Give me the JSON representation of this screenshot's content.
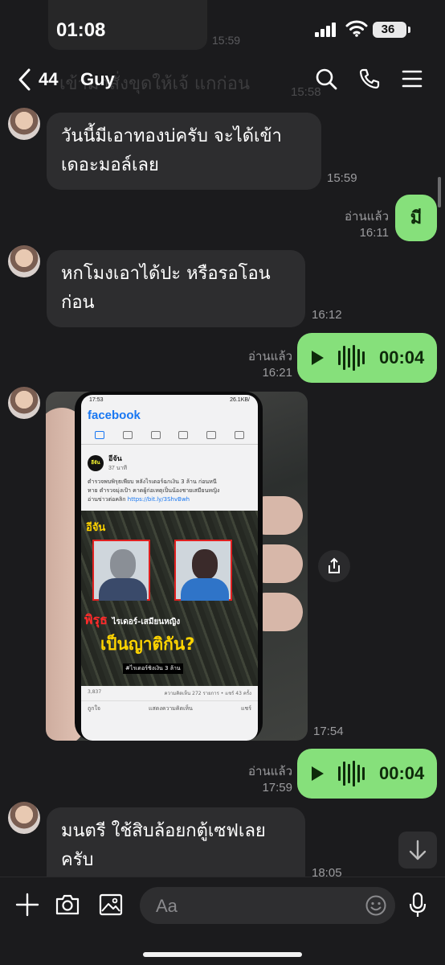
{
  "status_bar": {
    "time": "01:08",
    "battery": "36"
  },
  "ghost": {
    "faded_text": "เข้ามาสั่งขุดให้เจ้ แกก่อน",
    "time_top": "15:59",
    "time_header": "15:58"
  },
  "header": {
    "unread_count": "44",
    "contact_name": "Guy"
  },
  "messages": {
    "m1": {
      "text_line1": "วันนี้มีเอาทองบ่ครับ  จะได้เข้า",
      "text_line2": "เดอะมอล์เลย",
      "time": "15:59"
    },
    "m2": {
      "text": "มี",
      "read": "อ่านแล้ว",
      "time": "16:11"
    },
    "m3": {
      "text_line1": "หกโมงเอาได้ปะ หรือรอโอน",
      "text_line2": "ก่อน",
      "time": "16:12"
    },
    "m4": {
      "duration": "00:04",
      "read": "อ่านแล้ว",
      "time": "16:21"
    },
    "m5": {
      "time": "17:54",
      "phone": {
        "status_time": "17:53",
        "status_right": "26.1KB/",
        "app": "facebook",
        "page_avatar": "อีจัน",
        "page_name": "อีจัน",
        "post_date": "37 นาที",
        "post_line1": "ตำรวจพบพิรุธเพียบ หลังไรเดอร์ฉกเงิน 3 ล้าน ก่อนหนี",
        "post_line2": "หาย ตำรวจมุ่งเป้า คาดผู้ก่อเหตุเป็นน้องชายเสมียนหญิง",
        "post_line3": "อ่านข่าวต่อคลิก",
        "post_link": "https://bit.ly/3ShvBwh",
        "brand": "อีจัน",
        "headline_red": "พิรุธ",
        "headline_white": "ไรเดอร์-เสมียนหญิง",
        "headline_yellow": "เป็นญาติกัน?",
        "hashtag": "#ไรเดอร์ชิงเงิน 3 ล้าน",
        "reactions": "3,837",
        "stats": "ความคิดเห็น 272 รายการ • แชร์ 43 ครั้ง",
        "action_like": "ถูกใจ",
        "action_comment": "แสดงความคิดเห็น",
        "action_share": "แชร์"
      }
    },
    "m6": {
      "duration": "00:04",
      "read": "อ่านแล้ว",
      "time": "17:59"
    },
    "m7": {
      "text_line1": "มนตรี ใช้สิบล้อยกตู้เซฟเลย",
      "text_line2": "ครับ",
      "time": "18:05"
    }
  },
  "input": {
    "placeholder": "Aa"
  },
  "colors": {
    "bubble_out": "#86e07b",
    "bubble_in": "#2d2d2f",
    "background": "#1b1b1d",
    "fb_blue": "#1877f2"
  }
}
